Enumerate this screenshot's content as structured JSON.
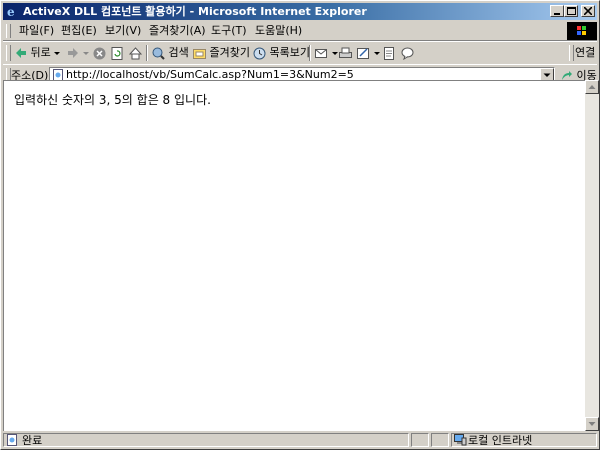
{
  "window": {
    "title": "ActiveX DLL 컴포넌트 활용하기 - Microsoft Internet Explorer"
  },
  "menu": {
    "items": [
      "파일(F)",
      "편집(E)",
      "보기(V)",
      "즐겨찾기(A)",
      "도구(T)",
      "도움말(H)"
    ]
  },
  "toolbar": {
    "back_label": "뒤로",
    "search_label": "검색",
    "favorites_label": "즐겨찾기",
    "history_label": "목록보기",
    "links_label": "연결"
  },
  "address": {
    "label": "주소(D)",
    "url": "http://localhost/vb/SumCalc.asp?Num1=3&Num2=5",
    "go_label": "이동"
  },
  "content": {
    "text": "입력하신 숫자의 3, 5의 합은 8 입니다."
  },
  "status": {
    "text": "완료",
    "zone": "로컬 인트라넷"
  }
}
